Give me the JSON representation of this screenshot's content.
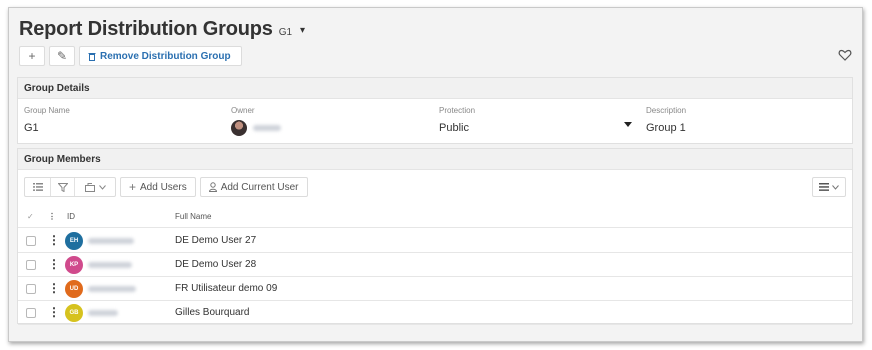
{
  "header": {
    "title": "Report Distribution Groups",
    "subtitle": "G1",
    "caret": "▾"
  },
  "toolbar": {
    "add_icon": "+",
    "edit_icon": "✎",
    "remove_label": "Remove Distribution Group"
  },
  "details": {
    "heading": "Group Details",
    "group_name_label": "Group Name",
    "group_name_value": "G1",
    "owner_label": "Owner",
    "protection_label": "Protection",
    "protection_value": "Public",
    "description_label": "Description",
    "description_value": "Group 1"
  },
  "members": {
    "heading": "Group Members",
    "add_users_label": "Add Users",
    "add_current_user_label": "Add Current User",
    "columns": {
      "check": "✓",
      "menu": "⋮",
      "id": "ID",
      "full_name": "Full Name"
    },
    "rows": [
      {
        "initials": "EH",
        "color": "#1f6f9f",
        "full_name": "DE Demo User 27"
      },
      {
        "initials": "KP",
        "color": "#d04a8c",
        "full_name": "DE Demo User 28"
      },
      {
        "initials": "UD",
        "color": "#e06a1c",
        "full_name": "FR Utilisateur demo 09"
      },
      {
        "initials": "GB",
        "color": "#d6c21e",
        "full_name": "Gilles Bourquard"
      }
    ]
  }
}
